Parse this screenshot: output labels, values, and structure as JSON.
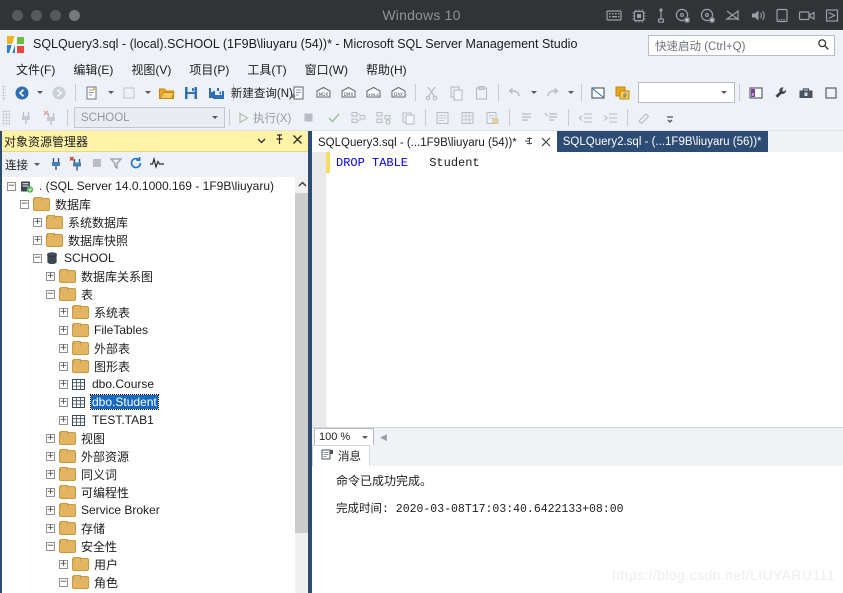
{
  "host_bar": {
    "title": "Windows 10",
    "traffic_lights": [
      "close-light",
      "minimize-light",
      "zoom-light",
      "extra-light"
    ],
    "status_icons": [
      "keyboard-icon",
      "cpu-icon",
      "usb-icon",
      "disc-eject-icon",
      "disc-eject-icon-2",
      "network-disconnected-icon",
      "sound-icon",
      "battery-icon",
      "camera-icon",
      "share-screen-icon"
    ]
  },
  "window": {
    "title": "SQLQuery3.sql - (local).SCHOOL (1F9B\\liuyaru (54))* - Microsoft SQL Server Management Studio",
    "quick_launch_placeholder": "快速启动 (Ctrl+Q)",
    "quick_launch_value": ""
  },
  "menu": {
    "items": [
      {
        "label": "文件(F)"
      },
      {
        "label": "编辑(E)"
      },
      {
        "label": "视图(V)"
      },
      {
        "label": "项目(P)"
      },
      {
        "label": "工具(T)"
      },
      {
        "label": "窗口(W)"
      },
      {
        "label": "帮助(H)"
      }
    ]
  },
  "toolbar1": {
    "new_query_label": "新建查询(N)",
    "buttons": [
      {
        "name": "navigate-back-button",
        "glyph": "◀"
      },
      {
        "name": "navigate-forward-button",
        "glyph": "▶"
      },
      {
        "name": "new-item-button",
        "glyph": "▤"
      },
      {
        "name": "new-project-button",
        "glyph": "▢"
      },
      {
        "name": "open-file-button",
        "glyph": "📂"
      },
      {
        "name": "save-button",
        "glyph": "💾"
      },
      {
        "name": "save-all-button",
        "glyph": "💾"
      },
      {
        "name": "new-query-button",
        "glyph": "▤"
      },
      {
        "name": "new-analysis-query-button",
        "glyph": "▤"
      },
      {
        "name": "new-mdx-query-button",
        "glyph": "MDX"
      },
      {
        "name": "new-dmx-query-button",
        "glyph": "DMX"
      },
      {
        "name": "new-xmla-query-button",
        "glyph": "XMLA"
      },
      {
        "name": "new-dax-query-button",
        "glyph": "DAX"
      },
      {
        "name": "cut-button",
        "glyph": "✂"
      },
      {
        "name": "copy-button",
        "glyph": "⧉"
      },
      {
        "name": "paste-button",
        "glyph": "📋"
      },
      {
        "name": "undo-button",
        "glyph": "↶"
      },
      {
        "name": "redo-button",
        "glyph": "↷"
      },
      {
        "name": "registered-servers-button",
        "glyph": "▣"
      },
      {
        "name": "object-explorer-button",
        "glyph": "▣"
      },
      {
        "name": "template-explorer-button",
        "glyph": "▣"
      },
      {
        "name": "options-button",
        "glyph": "🔧"
      },
      {
        "name": "toolbox-button",
        "glyph": "🧰"
      }
    ]
  },
  "toolbar2": {
    "database_value": "SCHOOL",
    "execute_label": "执行(X)",
    "buttons": [
      {
        "name": "connect-button",
        "glyph": "⚲"
      },
      {
        "name": "disconnect-button",
        "glyph": "⚲"
      },
      {
        "name": "execute-button",
        "glyph": "▷"
      },
      {
        "name": "stop-button",
        "glyph": "■"
      },
      {
        "name": "parse-button",
        "glyph": "✓"
      },
      {
        "name": "display-estimated-plan-button",
        "glyph": "▤"
      },
      {
        "name": "include-actual-plan-button",
        "glyph": "▤"
      },
      {
        "name": "include-client-statistics-button",
        "glyph": "▤"
      },
      {
        "name": "results-to-text-button",
        "glyph": "▤"
      },
      {
        "name": "results-to-grid-button",
        "glyph": "▦"
      },
      {
        "name": "results-to-file-button",
        "glyph": "▣"
      },
      {
        "name": "comment-button",
        "glyph": "≡"
      },
      {
        "name": "uncomment-button",
        "glyph": "≡"
      },
      {
        "name": "decrease-indent-button",
        "glyph": "⇤"
      },
      {
        "name": "increase-indent-button",
        "glyph": "⇥"
      },
      {
        "name": "specify-values-button",
        "glyph": "✎"
      }
    ]
  },
  "object_explorer": {
    "panel_title": "对象资源管理器",
    "panel_actions": [
      "chevron-down-icon",
      "pin-icon",
      "close-icon"
    ],
    "toolbar": {
      "connect_label": "连接",
      "buttons": [
        {
          "name": "connect-object-explorer-button"
        },
        {
          "name": "disconnect-object-explorer-button"
        },
        {
          "name": "stop-button"
        },
        {
          "name": "filter-icon"
        },
        {
          "name": "refresh-icon"
        },
        {
          "name": "activity-monitor-icon"
        }
      ]
    },
    "tree": [
      {
        "label": ". (SQL Server 14.0.1000.169 - 1F9B\\liuyaru)",
        "indent": 0,
        "expander": "minus",
        "icon": "server-icon"
      },
      {
        "label": "数据库",
        "indent": 1,
        "expander": "minus",
        "icon": "folder-icon"
      },
      {
        "label": "系统数据库",
        "indent": 2,
        "expander": "plus",
        "icon": "folder-icon"
      },
      {
        "label": "数据库快照",
        "indent": 2,
        "expander": "plus",
        "icon": "folder-icon"
      },
      {
        "label": "SCHOOL",
        "indent": 2,
        "expander": "minus",
        "icon": "database-icon"
      },
      {
        "label": "数据库关系图",
        "indent": 3,
        "expander": "plus",
        "icon": "folder-icon"
      },
      {
        "label": "表",
        "indent": 3,
        "expander": "minus",
        "icon": "folder-icon"
      },
      {
        "label": "系统表",
        "indent": 4,
        "expander": "plus",
        "icon": "folder-icon"
      },
      {
        "label": "FileTables",
        "indent": 4,
        "expander": "plus",
        "icon": "folder-icon"
      },
      {
        "label": "外部表",
        "indent": 4,
        "expander": "plus",
        "icon": "folder-icon"
      },
      {
        "label": "图形表",
        "indent": 4,
        "expander": "plus",
        "icon": "folder-icon"
      },
      {
        "label": "dbo.Course",
        "indent": 4,
        "expander": "plus",
        "icon": "table-icon"
      },
      {
        "label": "dbo.Student",
        "indent": 4,
        "expander": "plus",
        "icon": "table-icon",
        "selected": true
      },
      {
        "label": "TEST.TAB1",
        "indent": 4,
        "expander": "plus",
        "icon": "table-icon"
      },
      {
        "label": "视图",
        "indent": 3,
        "expander": "plus",
        "icon": "folder-icon"
      },
      {
        "label": "外部资源",
        "indent": 3,
        "expander": "plus",
        "icon": "folder-icon"
      },
      {
        "label": "同义词",
        "indent": 3,
        "expander": "plus",
        "icon": "folder-icon"
      },
      {
        "label": "可编程性",
        "indent": 3,
        "expander": "plus",
        "icon": "folder-icon"
      },
      {
        "label": "Service Broker",
        "indent": 3,
        "expander": "plus",
        "icon": "folder-icon"
      },
      {
        "label": "存储",
        "indent": 3,
        "expander": "plus",
        "icon": "folder-icon"
      },
      {
        "label": "安全性",
        "indent": 3,
        "expander": "minus",
        "icon": "folder-icon"
      },
      {
        "label": "用户",
        "indent": 4,
        "expander": "plus",
        "icon": "folder-icon"
      },
      {
        "label": "角色",
        "indent": 4,
        "expander": "minus",
        "icon": "folder-icon"
      }
    ]
  },
  "editor": {
    "tabs": [
      {
        "label": "SQLQuery3.sql - (...1F9B\\liuyaru (54))*",
        "active": true
      },
      {
        "label": "SQLQuery2.sql - (...1F9B\\liuyaru (56))*",
        "active": false
      }
    ],
    "tab_pin_icon": "pin-icon",
    "tab_close_icon": "close-icon",
    "code": {
      "keyword": "DROP TABLE",
      "identifier": "Student"
    },
    "zoom_level": "100 %"
  },
  "results": {
    "tab_label": "消息",
    "tab_icon": "message-icon",
    "lines": [
      "命令已成功完成。",
      "完成时间: 2020-03-08T17:03:40.6422133+08:00"
    ]
  },
  "watermark": "https://blog.csdn.net/LIUYARU111",
  "colors": {
    "host_bar": "#313337",
    "chrome": "#eef1f6",
    "panel_title_bar": "#fff3a8",
    "selection_blue": "#1669c1",
    "inactive_tab_blue": "#2d4c73",
    "keyword_blue": "#0000ff",
    "change_bar_yellow": "#fada5f"
  }
}
